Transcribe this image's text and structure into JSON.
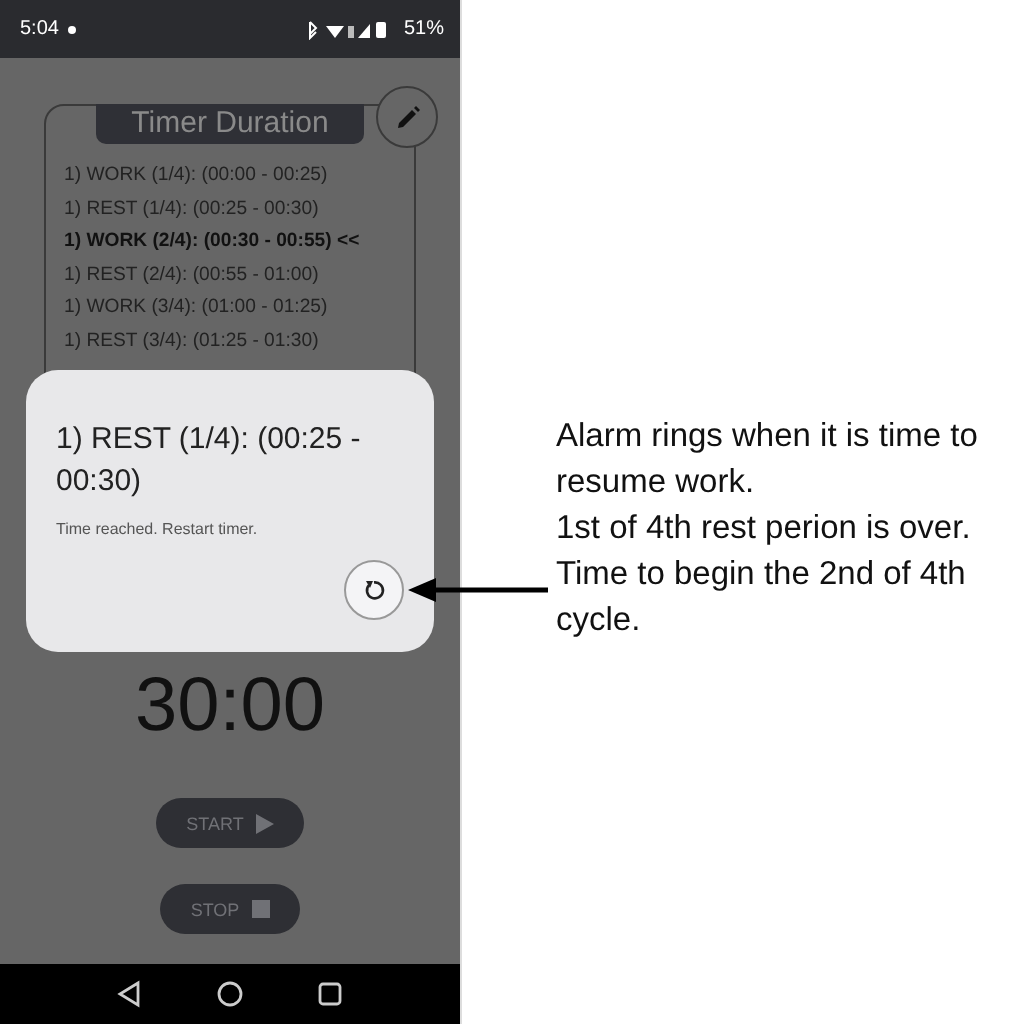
{
  "status_bar": {
    "time": "5:04",
    "battery": "51%"
  },
  "timer_duration": {
    "title": "Timer Duration",
    "rows": [
      {
        "text": "1) WORK (1/4): (00:00 - 00:25)",
        "current": false
      },
      {
        "text": "1) REST (1/4): (00:25 - 00:30)",
        "current": false
      },
      {
        "text": "1) WORK (2/4): (00:30 - 00:55) <<",
        "current": true
      },
      {
        "text": "1) REST (2/4): (00:55 - 01:00)",
        "current": false
      },
      {
        "text": "1) WORK (3/4): (01:00 - 01:25)",
        "current": false
      },
      {
        "text": "1) REST (3/4): (01:25 - 01:30)",
        "current": false
      }
    ]
  },
  "dialog": {
    "title": "1) REST (1/4): (00:25 - 00:30)",
    "message": "Time reached. Restart timer."
  },
  "timer": {
    "display": "30:00"
  },
  "buttons": [
    {
      "label": "START",
      "kind": "start"
    },
    {
      "label": "STOP",
      "kind": "stop"
    }
  ],
  "annotations": [
    "Alarm rings when it is time to resume work.",
    "1st of 4th rest perion is over. Time to begin the 2nd of 4th cycle."
  ]
}
